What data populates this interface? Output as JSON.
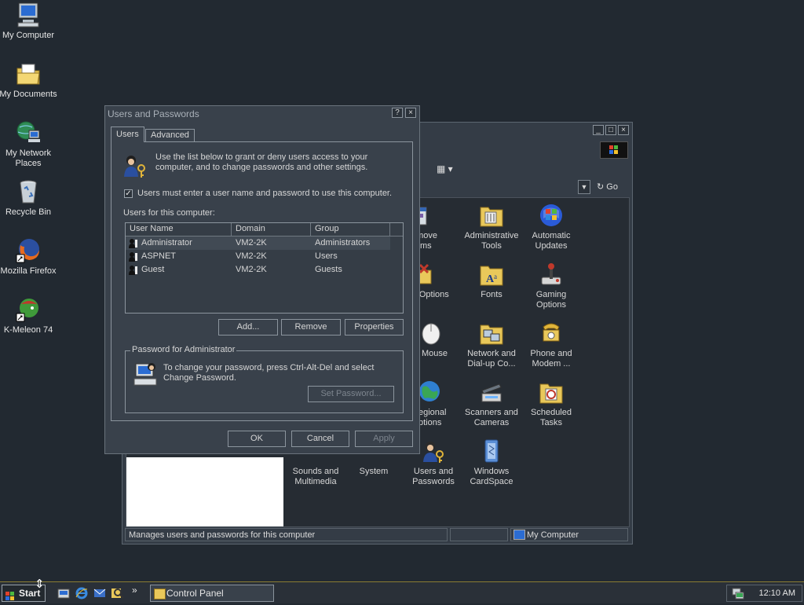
{
  "desktop": {
    "icons": [
      {
        "label": "My Computer"
      },
      {
        "label": "My Documents"
      },
      {
        "label": "My Network Places"
      },
      {
        "label": "Recycle Bin"
      },
      {
        "label": "Mozilla Firefox"
      },
      {
        "label": "K-Meleon 74"
      }
    ]
  },
  "control_panel": {
    "title_buttons": [
      "_",
      "□",
      "×"
    ],
    "address_go": "Go",
    "items": [
      {
        "label": "Add/Remove Programs",
        "visible_label": "/Remove\nograms"
      },
      {
        "label": "Administrative Tools"
      },
      {
        "label": "Automatic Updates"
      },
      {
        "label": "Folder Options",
        "visible_label": "er Options"
      },
      {
        "label": "Fonts"
      },
      {
        "label": "Gaming Options"
      },
      {
        "label": "Mouse",
        "visible_label": "Mouse"
      },
      {
        "label": "Network and Dial-up Co..."
      },
      {
        "label": "Phone and Modem ..."
      },
      {
        "label": "Regional Options",
        "visible_label": "egional\nptions"
      },
      {
        "label": "Scanners and Cameras"
      },
      {
        "label": "Scheduled Tasks"
      },
      {
        "label": "Sounds and Multimedia"
      },
      {
        "label": "System"
      },
      {
        "label": "Users and Passwords"
      },
      {
        "label": "Windows CardSpace"
      }
    ],
    "status": {
      "text": "Manages users and passwords for this computer",
      "location": "My Computer"
    }
  },
  "dialog": {
    "title": "Users and Passwords",
    "help_button": "?",
    "close_button": "×",
    "tabs": [
      "Users",
      "Advanced"
    ],
    "intro": "Use the list below to grant or deny users access to your computer, and to change passwords and other settings.",
    "require_login_label": "Users must enter a user name and password to use this computer.",
    "require_login_checked": "✓",
    "users_label": "Users for this computer:",
    "columns": [
      "User Name",
      "Domain",
      "Group"
    ],
    "users": [
      {
        "name": "Administrator",
        "domain": "VM2-2K",
        "group": "Administrators"
      },
      {
        "name": "ASPNET",
        "domain": "VM2-2K",
        "group": "Users"
      },
      {
        "name": "Guest",
        "domain": "VM2-2K",
        "group": "Guests"
      }
    ],
    "buttons": {
      "add": "Add...",
      "remove": "Remove",
      "properties": "Properties"
    },
    "password_group": {
      "legend": "Password for Administrator",
      "text": "To change your password, press Ctrl-Alt-Del and select Change Password.",
      "set_password": "Set Password..."
    },
    "footer": {
      "ok": "OK",
      "cancel": "Cancel",
      "apply": "Apply"
    }
  },
  "taskbar": {
    "start_label": "Start",
    "quick_launch_more": "»",
    "task": "Control Panel",
    "clock": "12:10 AM"
  }
}
